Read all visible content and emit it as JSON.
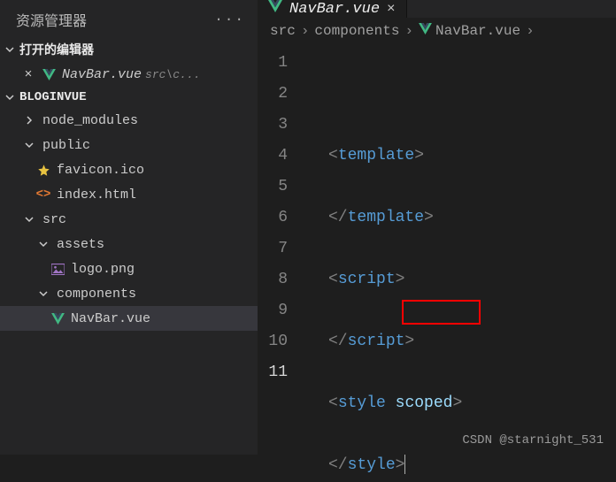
{
  "sidebar": {
    "title": "资源管理器",
    "openEditors": {
      "label": "打开的编辑器",
      "items": [
        {
          "name": "NavBar.vue",
          "hint": "src\\c..."
        }
      ]
    },
    "project": {
      "name": "BLOGINVUE",
      "tree": [
        {
          "label": "node_modules",
          "icon": "chevron-right",
          "indent": 1
        },
        {
          "label": "public",
          "icon": "chevron-down",
          "indent": 1
        },
        {
          "label": "favicon.ico",
          "icon": "star",
          "indent": 2
        },
        {
          "label": "index.html",
          "icon": "html",
          "indent": 2
        },
        {
          "label": "src",
          "icon": "chevron-down",
          "indent": 1
        },
        {
          "label": "assets",
          "icon": "chevron-down",
          "indent": 2
        },
        {
          "label": "logo.png",
          "icon": "image",
          "indent": 3
        },
        {
          "label": "components",
          "icon": "chevron-down",
          "indent": 2
        },
        {
          "label": "NavBar.vue",
          "icon": "vue",
          "indent": 3,
          "active": true
        }
      ]
    }
  },
  "editor": {
    "tab": {
      "name": "NavBar.vue"
    },
    "breadcrumbs": [
      "src",
      "components",
      "NavBar.vue"
    ],
    "code": {
      "lineNumbers": [
        "1",
        "2",
        "3",
        "4",
        "5",
        "6",
        "7",
        "8",
        "9",
        "10",
        "11"
      ],
      "currentLine": 11,
      "lines": [
        {
          "t": "open",
          "tag": "template"
        },
        {
          "t": "blank"
        },
        {
          "t": "close",
          "tag": "template"
        },
        {
          "t": "blank"
        },
        {
          "t": "open",
          "tag": "script"
        },
        {
          "t": "blank"
        },
        {
          "t": "close",
          "tag": "script"
        },
        {
          "t": "blank"
        },
        {
          "t": "openattr",
          "tag": "style",
          "attr": "scoped"
        },
        {
          "t": "blank"
        },
        {
          "t": "close",
          "tag": "style",
          "cursor": true
        }
      ]
    }
  },
  "watermark": "CSDN @starnight_531"
}
